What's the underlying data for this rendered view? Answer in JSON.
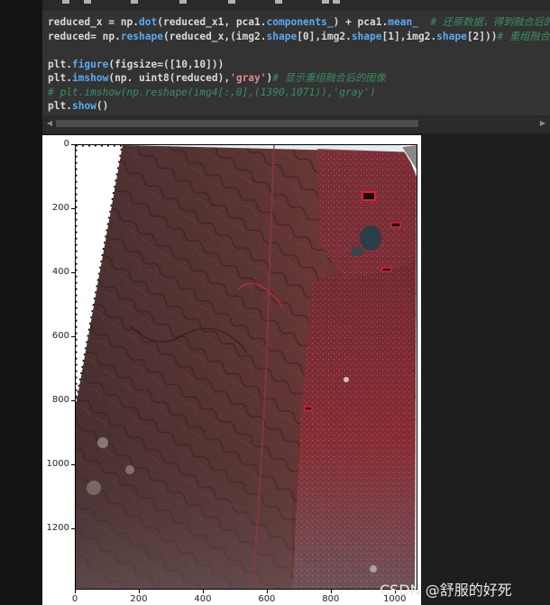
{
  "code_cell": {
    "lines": [
      [
        {
          "t": "reduced_x = np.",
          "c": "#d9d9d9"
        },
        {
          "t": "dot",
          "c": "#5fa8f0"
        },
        {
          "t": "(reduced_x1, pca1.",
          "c": "#d9d9d9"
        },
        {
          "t": "components_",
          "c": "#5fa8f0"
        },
        {
          "t": ") + pca1.",
          "c": "#d9d9d9"
        },
        {
          "t": "mean_",
          "c": "#5fa8f0"
        },
        {
          "t": "  # 还原数据，得到融合后的数",
          "c": "#3c8c64",
          "i": true
        }
      ],
      [
        {
          "t": "reduced= np.",
          "c": "#d9d9d9"
        },
        {
          "t": "reshape",
          "c": "#5fa8f0"
        },
        {
          "t": "(reduced_x,(img2.",
          "c": "#d9d9d9"
        },
        {
          "t": "shape",
          "c": "#5fa8f0"
        },
        {
          "t": "[0],img2.",
          "c": "#d9d9d9"
        },
        {
          "t": "shape",
          "c": "#5fa8f0"
        },
        {
          "t": "[1],img2.",
          "c": "#d9d9d9"
        },
        {
          "t": "shape",
          "c": "#5fa8f0"
        },
        {
          "t": "[2]))",
          "c": "#d9d9d9"
        },
        {
          "t": "# 重组融合后的",
          "c": "#3c8c64",
          "i": true
        }
      ],
      [],
      [
        {
          "t": "plt.",
          "c": "#d9d9d9"
        },
        {
          "t": "figure",
          "c": "#5fa8f0"
        },
        {
          "t": "(figsize=([10,10]))",
          "c": "#d9d9d9"
        }
      ],
      [
        {
          "t": "plt.",
          "c": "#d9d9d9"
        },
        {
          "t": "imshow",
          "c": "#5fa8f0"
        },
        {
          "t": "(np. uint8(reduced),",
          "c": "#d9d9d9"
        },
        {
          "t": "'gray'",
          "c": "#e28a8a"
        },
        {
          "t": ")",
          "c": "#d9d9d9"
        },
        {
          "t": "# 显示重组融合后的图像",
          "c": "#3c8c64",
          "i": true
        }
      ],
      [
        {
          "t": "# plt.imshow(np.reshape(img4[:,0],(1390,1071)),'gray')",
          "c": "#3c8c64",
          "i": true
        }
      ],
      [
        {
          "t": "plt.",
          "c": "#d9d9d9"
        },
        {
          "t": "show",
          "c": "#5fa8f0"
        },
        {
          "t": "()",
          "c": "#d9d9d9"
        }
      ]
    ]
  },
  "scrollbar": {
    "left_arrow": "◀",
    "right_arrow": "▶"
  },
  "chart_data": {
    "type": "image",
    "yticks": [
      0,
      200,
      400,
      600,
      800,
      1000,
      1200
    ],
    "xticks": [
      0,
      200,
      400,
      600,
      800,
      1000
    ],
    "xlim": [
      0,
      1071
    ],
    "ylim": [
      1390,
      0
    ]
  },
  "watermark": "CSDN @舒服的好死"
}
